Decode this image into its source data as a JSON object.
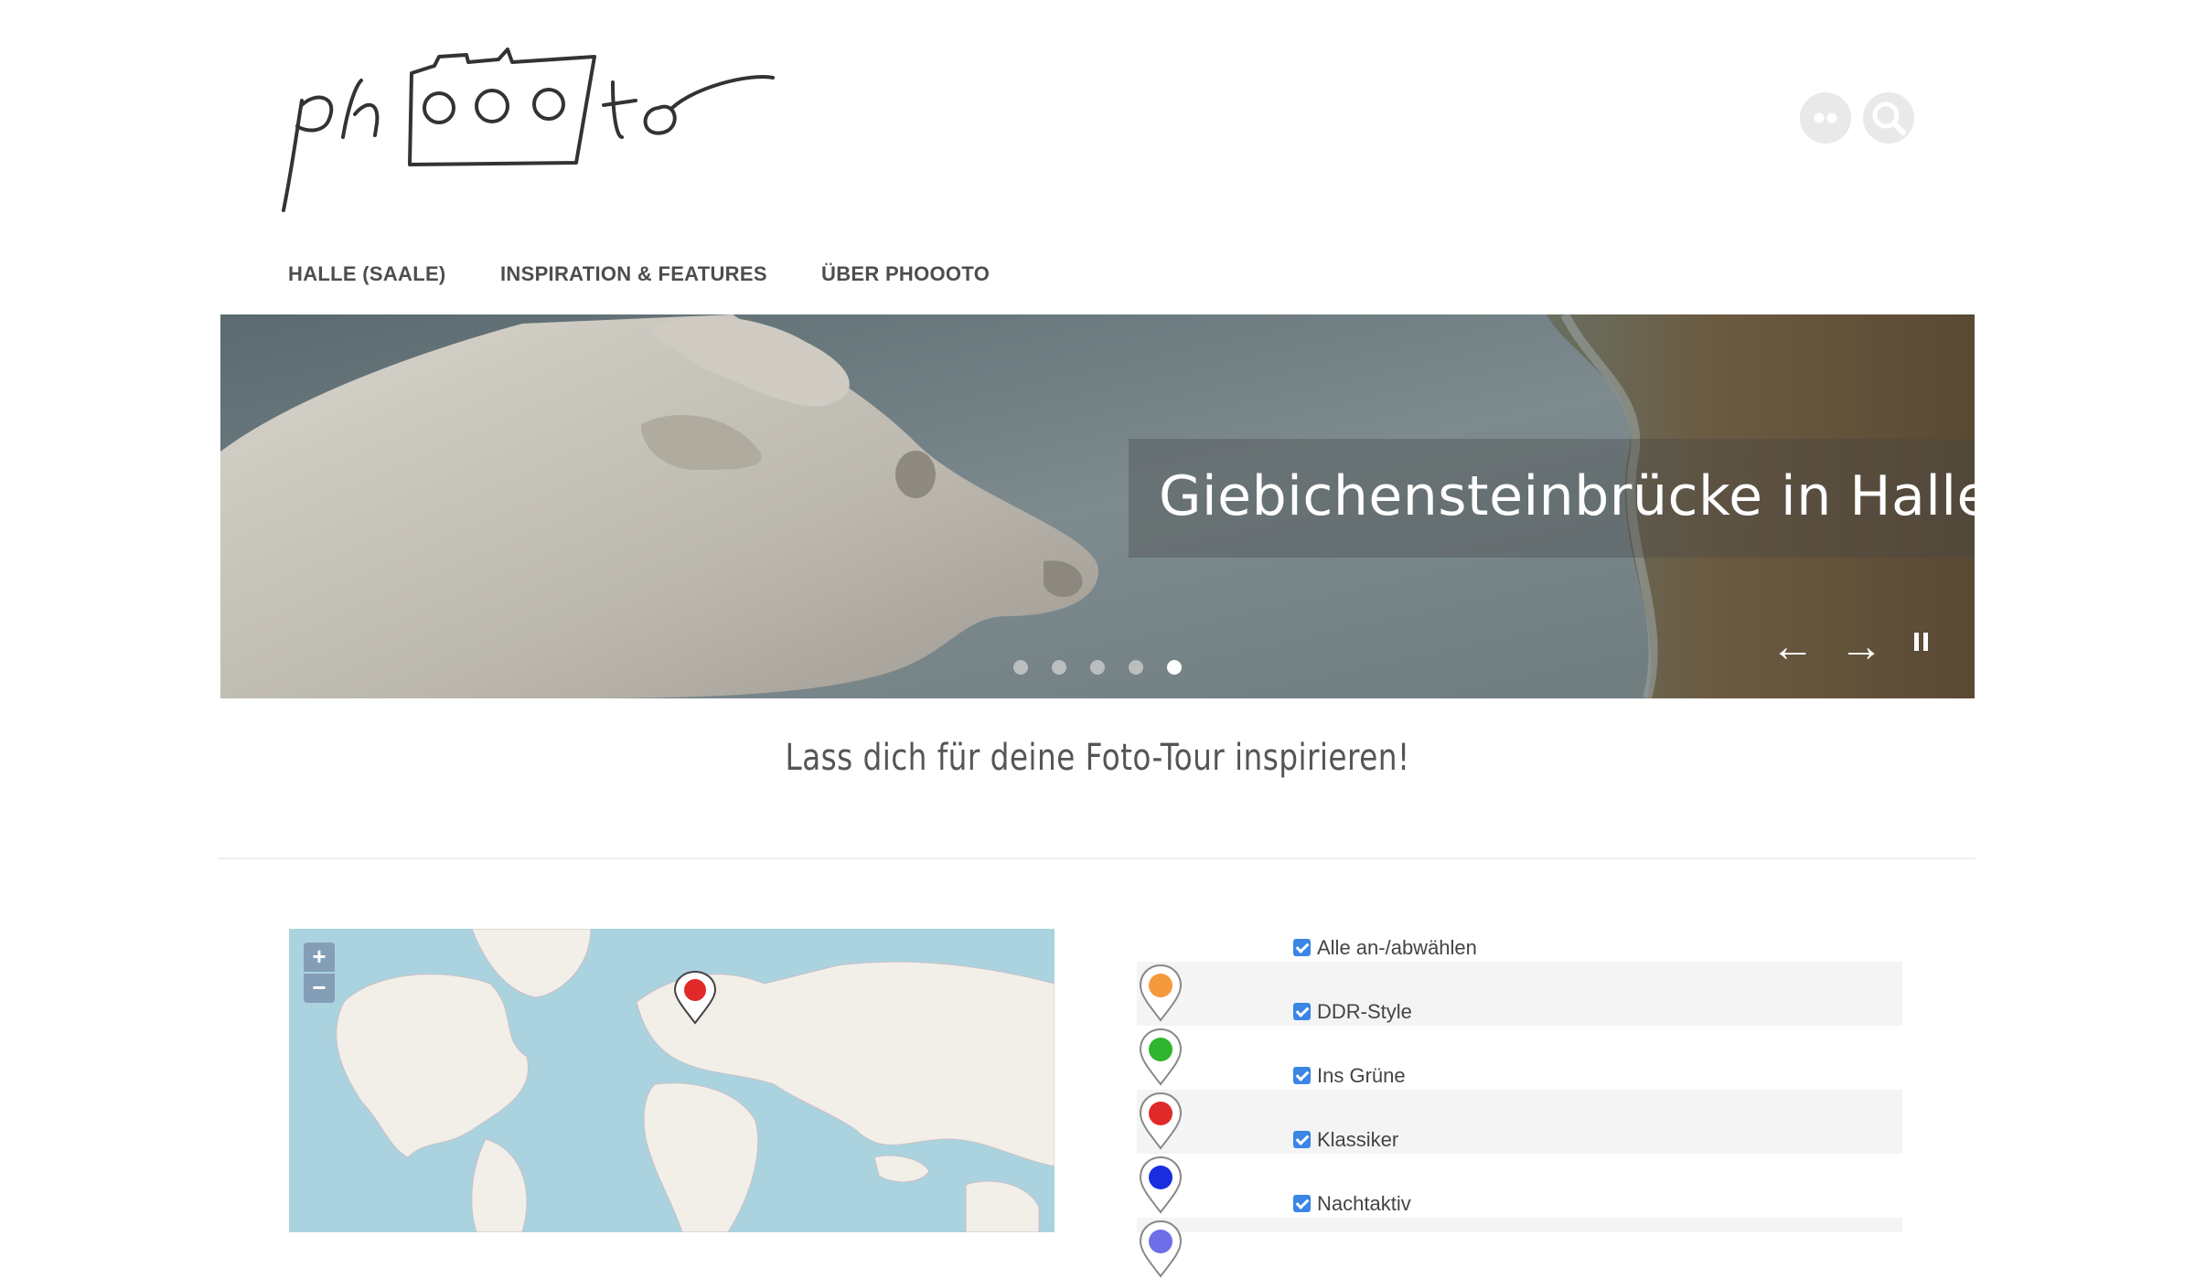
{
  "header": {
    "logo_text": "phooo to",
    "flickr_icon": "flickr-icon",
    "search_icon": "search-icon"
  },
  "nav": {
    "items": [
      {
        "label": "HALLE (SAALE)"
      },
      {
        "label": "INSPIRATION & FEATURES"
      },
      {
        "label": "ÜBER PHOOOTO"
      }
    ]
  },
  "hero": {
    "caption": "Giebichensteinbrücke in Halle",
    "slides_total": 5,
    "active_slide": 5,
    "prev_label": "←",
    "next_label": "→"
  },
  "subtitle": "Lass dich für deine Foto-Tour inspirieren!",
  "map": {
    "zoom_in_label": "+",
    "zoom_out_label": "−"
  },
  "legend": {
    "items": [
      {
        "label": "Alle an-/abwählen",
        "checked": true,
        "pin_color": ""
      },
      {
        "label": "DDR-Style",
        "checked": true,
        "pin_color": "#f59a3c"
      },
      {
        "label": "Ins Grüne",
        "checked": true,
        "pin_color": "#2fb52f"
      },
      {
        "label": "Klassiker",
        "checked": true,
        "pin_color": "#e02a2a"
      },
      {
        "label": "Nachtaktiv",
        "checked": true,
        "pin_color": "#1a2ee0"
      }
    ]
  },
  "colors": {
    "accent_checkbox": "#3a86e6",
    "map_water": "#aad3df",
    "map_land": "#f2efe9"
  }
}
